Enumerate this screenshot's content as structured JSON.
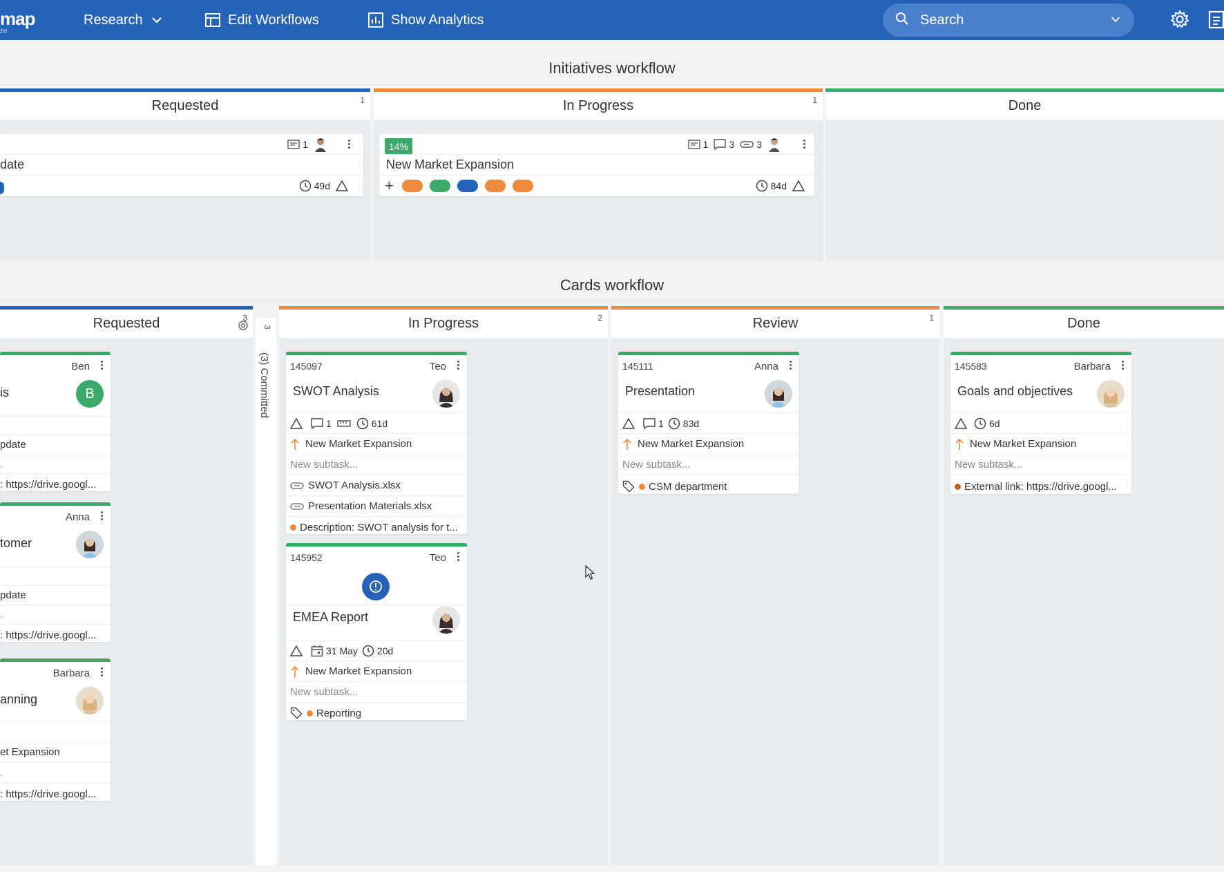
{
  "topbar": {
    "logo": "map",
    "logo_sub": "ze",
    "nav": [
      {
        "label": "Research",
        "icon": "chevron-down-icon"
      },
      {
        "label": "Edit Workflows",
        "icon": "table-icon"
      },
      {
        "label": "Show Analytics",
        "icon": "bar-chart-icon"
      }
    ],
    "search_placeholder": "Search"
  },
  "initiatives": {
    "title": "Initiatives workflow",
    "columns": [
      {
        "name": "Requested",
        "count": "1",
        "color": "#2563b8"
      },
      {
        "name": "In Progress",
        "count": "1",
        "color": "#ef8a3c"
      },
      {
        "name": "Done",
        "count": "",
        "color": "#3aa969"
      }
    ],
    "cards": [
      {
        "title": "date",
        "notes": "1",
        "age": "49d"
      },
      {
        "title": "New Market Expansion",
        "progress": "14%",
        "notes": "1",
        "comments": "3",
        "links": "3",
        "age": "84d",
        "plus": "+",
        "pills": [
          "#ef8a3c",
          "#3aa969",
          "#2563b8",
          "#ef8a3c",
          "#ef8a3c"
        ]
      }
    ]
  },
  "cards_wf": {
    "title": "Cards workflow",
    "columns": [
      {
        "name": "Requested",
        "count": "3",
        "color": "#2563b8"
      },
      {
        "name": "In Progress",
        "count": "2",
        "color": "#ef8a3c"
      },
      {
        "name": "Review",
        "count": "1",
        "color": "#ef8a3c"
      },
      {
        "name": "Done",
        "count": "",
        "color": "#3aa969"
      }
    ],
    "collapsed_lane": {
      "count": "3",
      "label": "(3) Committed"
    },
    "requested_cards": [
      {
        "owner": "Ben",
        "title": "is",
        "avatar_letter": "B",
        "r1": "pdate",
        "r2": ".",
        "r3": ": https://drive.googl..."
      },
      {
        "owner": "Anna",
        "title": "tomer",
        "r1": "pdate",
        "r2": ".",
        "r3": ": https://drive.googl..."
      },
      {
        "owner": "Barbara",
        "title": "anning",
        "r1": "et Expansion",
        "r2": ".",
        "r3": ": https://drive.googl..."
      }
    ],
    "inprogress_cards": [
      {
        "id": "145097",
        "owner": "Teo",
        "title": "SWOT Analysis",
        "comments": "1",
        "age": "61d",
        "parent": "New Market Expansion",
        "subtask": "New subtask...",
        "files": [
          "SWOT Analysis.xlsx",
          "Presentation Materials.xlsx"
        ],
        "desc": "Description: SWOT analysis for t..."
      },
      {
        "id": "145952",
        "owner": "Teo",
        "title": "EMEA Report",
        "due": "31 May",
        "age": "20d",
        "parent": "New Market Expansion",
        "subtask": "New subtask...",
        "tag": "Reporting"
      }
    ],
    "review_cards": [
      {
        "id": "145111",
        "owner": "Anna",
        "title": "Presentation",
        "comments": "1",
        "age": "83d",
        "parent": "New Market Expansion",
        "subtask": "New subtask...",
        "tag": "CSM department"
      }
    ],
    "done_cards": [
      {
        "id": "145583",
        "owner": "Barbara",
        "title": "Goals and objectives",
        "age": "6d",
        "parent": "New Market Expansion",
        "subtask": "New subtask...",
        "link": "External link: https://drive.googl..."
      }
    ]
  },
  "colors": {
    "brand": "#2563b8",
    "green": "#3aa969",
    "orange": "#ef8a3c",
    "blocker": "#2563b8"
  }
}
